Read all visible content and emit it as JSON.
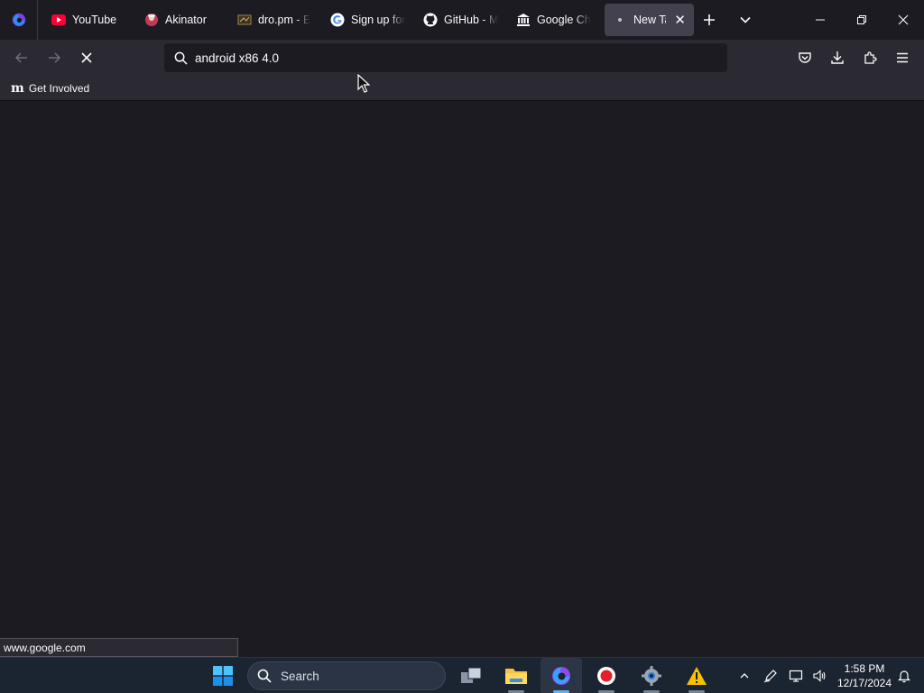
{
  "browser": {
    "tabs": [
      {
        "label": "YouTube",
        "icon": "youtube-icon"
      },
      {
        "label": "Akinator",
        "icon": "akinator-icon"
      },
      {
        "label": "dro.pm - E",
        "icon": "dropm-icon"
      },
      {
        "label": "Sign up for",
        "icon": "google-icon"
      },
      {
        "label": "GitHub - M",
        "icon": "github-icon"
      },
      {
        "label": "Google Ch",
        "icon": "museum-icon"
      },
      {
        "label": "New Tab",
        "icon": "loading-dot-icon",
        "active": true
      }
    ],
    "url_value": "android x86 4.0",
    "bookmarks": [
      {
        "label": "Get Involved",
        "icon": "m-logo-icon"
      }
    ],
    "status_url": "www.google.com"
  },
  "taskbar": {
    "search_label": "Search",
    "time": "1:58 PM",
    "date": "12/17/2024"
  },
  "colors": {
    "tab_strip": "#1c1b22",
    "toolbar": "#2b2a33",
    "active_tab": "#42414d",
    "taskbar": "#1b2431"
  }
}
